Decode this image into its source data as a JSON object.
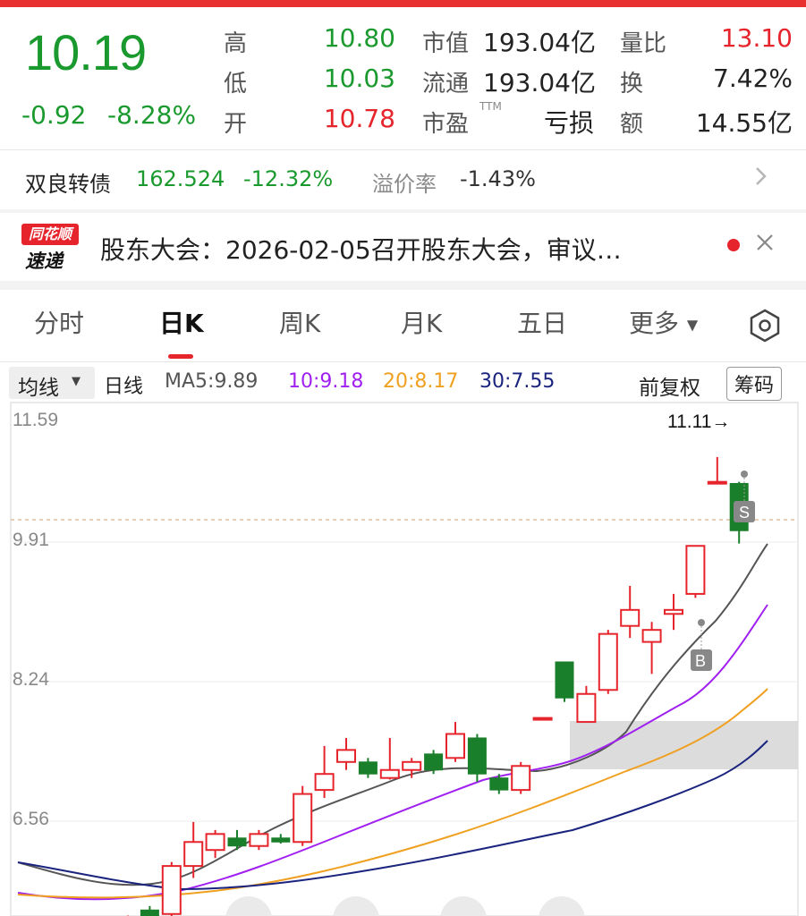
{
  "quote": {
    "price": "10.19",
    "change": "-0.92",
    "change_pct": "-8.28%",
    "rows": [
      {
        "label": "高",
        "value": "10.80",
        "label2": "市值",
        "value2": "193.04亿",
        "label3": "量比",
        "value3": "13.10"
      },
      {
        "label": "低",
        "value": "10.03",
        "label2": "流通",
        "value2": "193.04亿",
        "label3": "换",
        "value3": "7.42%"
      },
      {
        "label": "开",
        "value": "10.78",
        "label2": "市盈",
        "ttm": "TTM",
        "value2": "亏损",
        "label3": "额",
        "value3": "14.55亿"
      }
    ]
  },
  "bond": {
    "name": "双良转债",
    "price": "162.524",
    "pct": "-12.32%",
    "premium_label": "溢价率",
    "premium": "-1.43%"
  },
  "news": {
    "logo_top": "同花顺",
    "logo_bottom": "速递",
    "text": "股东大会：2026-02-05召开股东大会，审议…"
  },
  "tabs": [
    "分时",
    "日K",
    "周K",
    "月K",
    "五日",
    "更多"
  ],
  "active_tab": "日K",
  "ma": {
    "selector": "均线",
    "period": "日线",
    "ma5": "MA5:9.89",
    "ma10": "10:9.18",
    "ma20": "20:8.17",
    "ma30": "30:7.55",
    "adjust": "前复权",
    "chips": "筹码"
  },
  "colors": {
    "up": "#e6242c",
    "down": "#1a7f2a",
    "ma5": "#555555",
    "ma10": "#a020f0",
    "ma20": "#f0a020",
    "ma30": "#1a237e"
  },
  "chart_data": {
    "type": "candlestick",
    "y_ticks": [
      "11.59",
      "9.91",
      "8.24",
      "6.56"
    ],
    "high_marker": "11.11→",
    "markers": [
      "S",
      "B"
    ],
    "candles": [
      {
        "o": 5.2,
        "c": 5.35,
        "h": 5.38,
        "l": 5.15
      },
      {
        "o": 5.45,
        "c": 5.3,
        "h": 5.5,
        "l": 5.25
      },
      {
        "o": 5.4,
        "c": 6.0,
        "h": 6.05,
        "l": 5.3
      },
      {
        "o": 6.0,
        "c": 6.3,
        "h": 6.55,
        "l": 5.85
      },
      {
        "o": 6.2,
        "c": 6.4,
        "h": 6.45,
        "l": 6.1
      },
      {
        "o": 6.35,
        "c": 6.25,
        "h": 6.45,
        "l": 6.2
      },
      {
        "o": 6.25,
        "c": 6.4,
        "h": 6.45,
        "l": 6.2
      },
      {
        "o": 6.35,
        "c": 6.3,
        "h": 6.4,
        "l": 6.28
      },
      {
        "o": 6.3,
        "c": 6.9,
        "h": 7.0,
        "l": 6.25
      },
      {
        "o": 6.95,
        "c": 7.15,
        "h": 7.5,
        "l": 6.85
      },
      {
        "o": 7.3,
        "c": 7.45,
        "h": 7.6,
        "l": 7.2
      },
      {
        "o": 7.3,
        "c": 7.15,
        "h": 7.35,
        "l": 7.1
      },
      {
        "o": 7.1,
        "c": 7.2,
        "h": 7.6,
        "l": 7.08
      },
      {
        "o": 7.2,
        "c": 7.3,
        "h": 7.35,
        "l": 7.1
      },
      {
        "o": 7.4,
        "c": 7.2,
        "h": 7.45,
        "l": 7.15
      },
      {
        "o": 7.35,
        "c": 7.65,
        "h": 7.8,
        "l": 7.3
      },
      {
        "o": 7.6,
        "c": 7.15,
        "h": 7.65,
        "l": 7.05
      },
      {
        "o": 7.1,
        "c": 6.95,
        "h": 7.15,
        "l": 6.9
      },
      {
        "o": 6.95,
        "c": 7.25,
        "h": 7.3,
        "l": 6.9
      },
      {
        "o": 7.85,
        "c": 7.85,
        "h": 7.85,
        "l": 7.85
      },
      {
        "o": 8.55,
        "c": 8.1,
        "h": 8.55,
        "l": 8.05
      },
      {
        "o": 7.8,
        "c": 8.15,
        "h": 8.25,
        "l": 7.8
      },
      {
        "o": 8.2,
        "c": 8.9,
        "h": 8.95,
        "l": 8.15
      },
      {
        "o": 9.0,
        "c": 9.2,
        "h": 9.5,
        "l": 8.85
      },
      {
        "o": 8.8,
        "c": 8.95,
        "h": 9.05,
        "l": 8.4
      },
      {
        "o": 9.15,
        "c": 9.2,
        "h": 9.4,
        "l": 8.95
      },
      {
        "o": 9.4,
        "c": 10.0,
        "h": 10.0,
        "l": 9.35
      },
      {
        "o": 10.8,
        "c": 10.8,
        "h": 11.11,
        "l": 10.8
      },
      {
        "o": 10.78,
        "c": 10.19,
        "h": 10.8,
        "l": 10.03
      }
    ]
  }
}
